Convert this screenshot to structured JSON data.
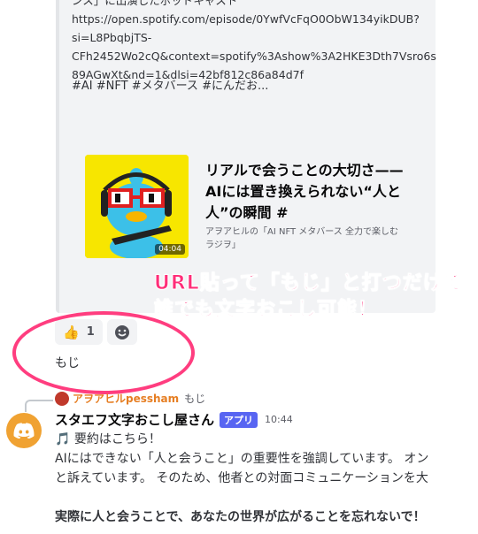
{
  "embed": {
    "lines": [
      "ンス」に出演したポッドキャスト",
      "https://open.spotify.com/episode/0YwfVcFqO0ObW134yikDUB?",
      "si=L8PbqbjTS-",
      "CFh2452Wo2cQ&context=spotify%3Ashow%3A2HKE3Dth7Vsro6s",
      "89AGwXt&nd=1&dlsi=42bf812c86a84d7f"
    ],
    "hashtags": "#AI #NFT #メタバース #にんだお..."
  },
  "card": {
    "title": "リアルで会うことの大切さ——AIには置き換えられない“人と人”の瞬間 #",
    "subtitle": "アヲアヒルの「AI NFT メタバース 全力で楽しむラジヲ」",
    "duration": "04:04"
  },
  "overlay": {
    "line1": "URL貼って「もじ」と打つだけで",
    "line2": "誰でも文字おこし可能！"
  },
  "reactions": {
    "thumbs_count": "1"
  },
  "message": {
    "text": "もじ"
  },
  "reply": {
    "name": "アヲアヒルpessham",
    "text": "もじ"
  },
  "bot": {
    "name": "スタエフ文字おこし屋さん",
    "badge": "アプリ",
    "time": "10:44",
    "line1": "要約はこちら！",
    "line2": "AIにはできない「人と会うこと」の重要性を強調しています。 オン",
    "line3": "と訴えています。 そのため、他者との対面コミュニケーションを大",
    "line4": "実際に人と会うことで、あなたの世界が広がることを忘れないで！"
  },
  "colors": {
    "accent": "#ff2d78",
    "app_badge": "#5865f2",
    "bot_avatar": "#f0a232"
  }
}
